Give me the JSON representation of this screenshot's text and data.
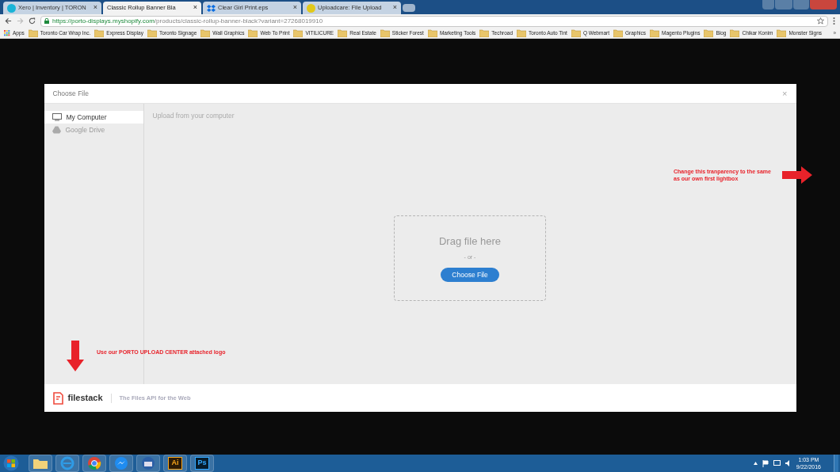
{
  "browser": {
    "tabs": [
      {
        "title": "Xero | Inventory | TORON",
        "selected": false
      },
      {
        "title": "Classic Rollup Banner Bla",
        "selected": true
      },
      {
        "title": "Clear Girl Print.eps",
        "selected": false
      },
      {
        "title": "Uploadcare: File Upload",
        "selected": false
      }
    ],
    "close_glyph": "×",
    "url_host": "https://porto-displays.myshopify.com",
    "url_path": "/products/classic-rollup-banner-black?variant=27268019910",
    "bookmarks": [
      "Apps",
      "Toronto Car Wrap Inc.",
      "Express Display",
      "Toronto Signage",
      "Wall Graphics",
      "Web To Print",
      "VITILICURE",
      "Real Estate",
      "Sticker Forest",
      "Marketing Tools",
      "Techroad",
      "Toronto Auto Tint",
      "Q Webmart",
      "Graphics",
      "Magento Plugins",
      "Blog",
      "Chikar Konim",
      "Monster Signs"
    ],
    "bookmarks_more": "»"
  },
  "dialog": {
    "title": "Choose File",
    "close": "×",
    "sources": [
      {
        "label": "My Computer",
        "selected": true
      },
      {
        "label": "Google Drive",
        "selected": false
      }
    ],
    "panel_title": "Upload from your computer",
    "drop_text": "Drag file here",
    "or_text": "- or -",
    "button": "Choose File",
    "footer_brand": "filestack",
    "footer_tagline": "The Files API for the Web"
  },
  "annotations": [
    {
      "text": "Change this tranparency to the same as our own first lightbox"
    },
    {
      "text": "Use our PORTO UPLOAD CENTER attached logo"
    }
  ],
  "taskbar": {
    "ai_label": "Ai",
    "ps_label": "Ps",
    "time": "1:03 PM",
    "date": "9/22/2016"
  }
}
